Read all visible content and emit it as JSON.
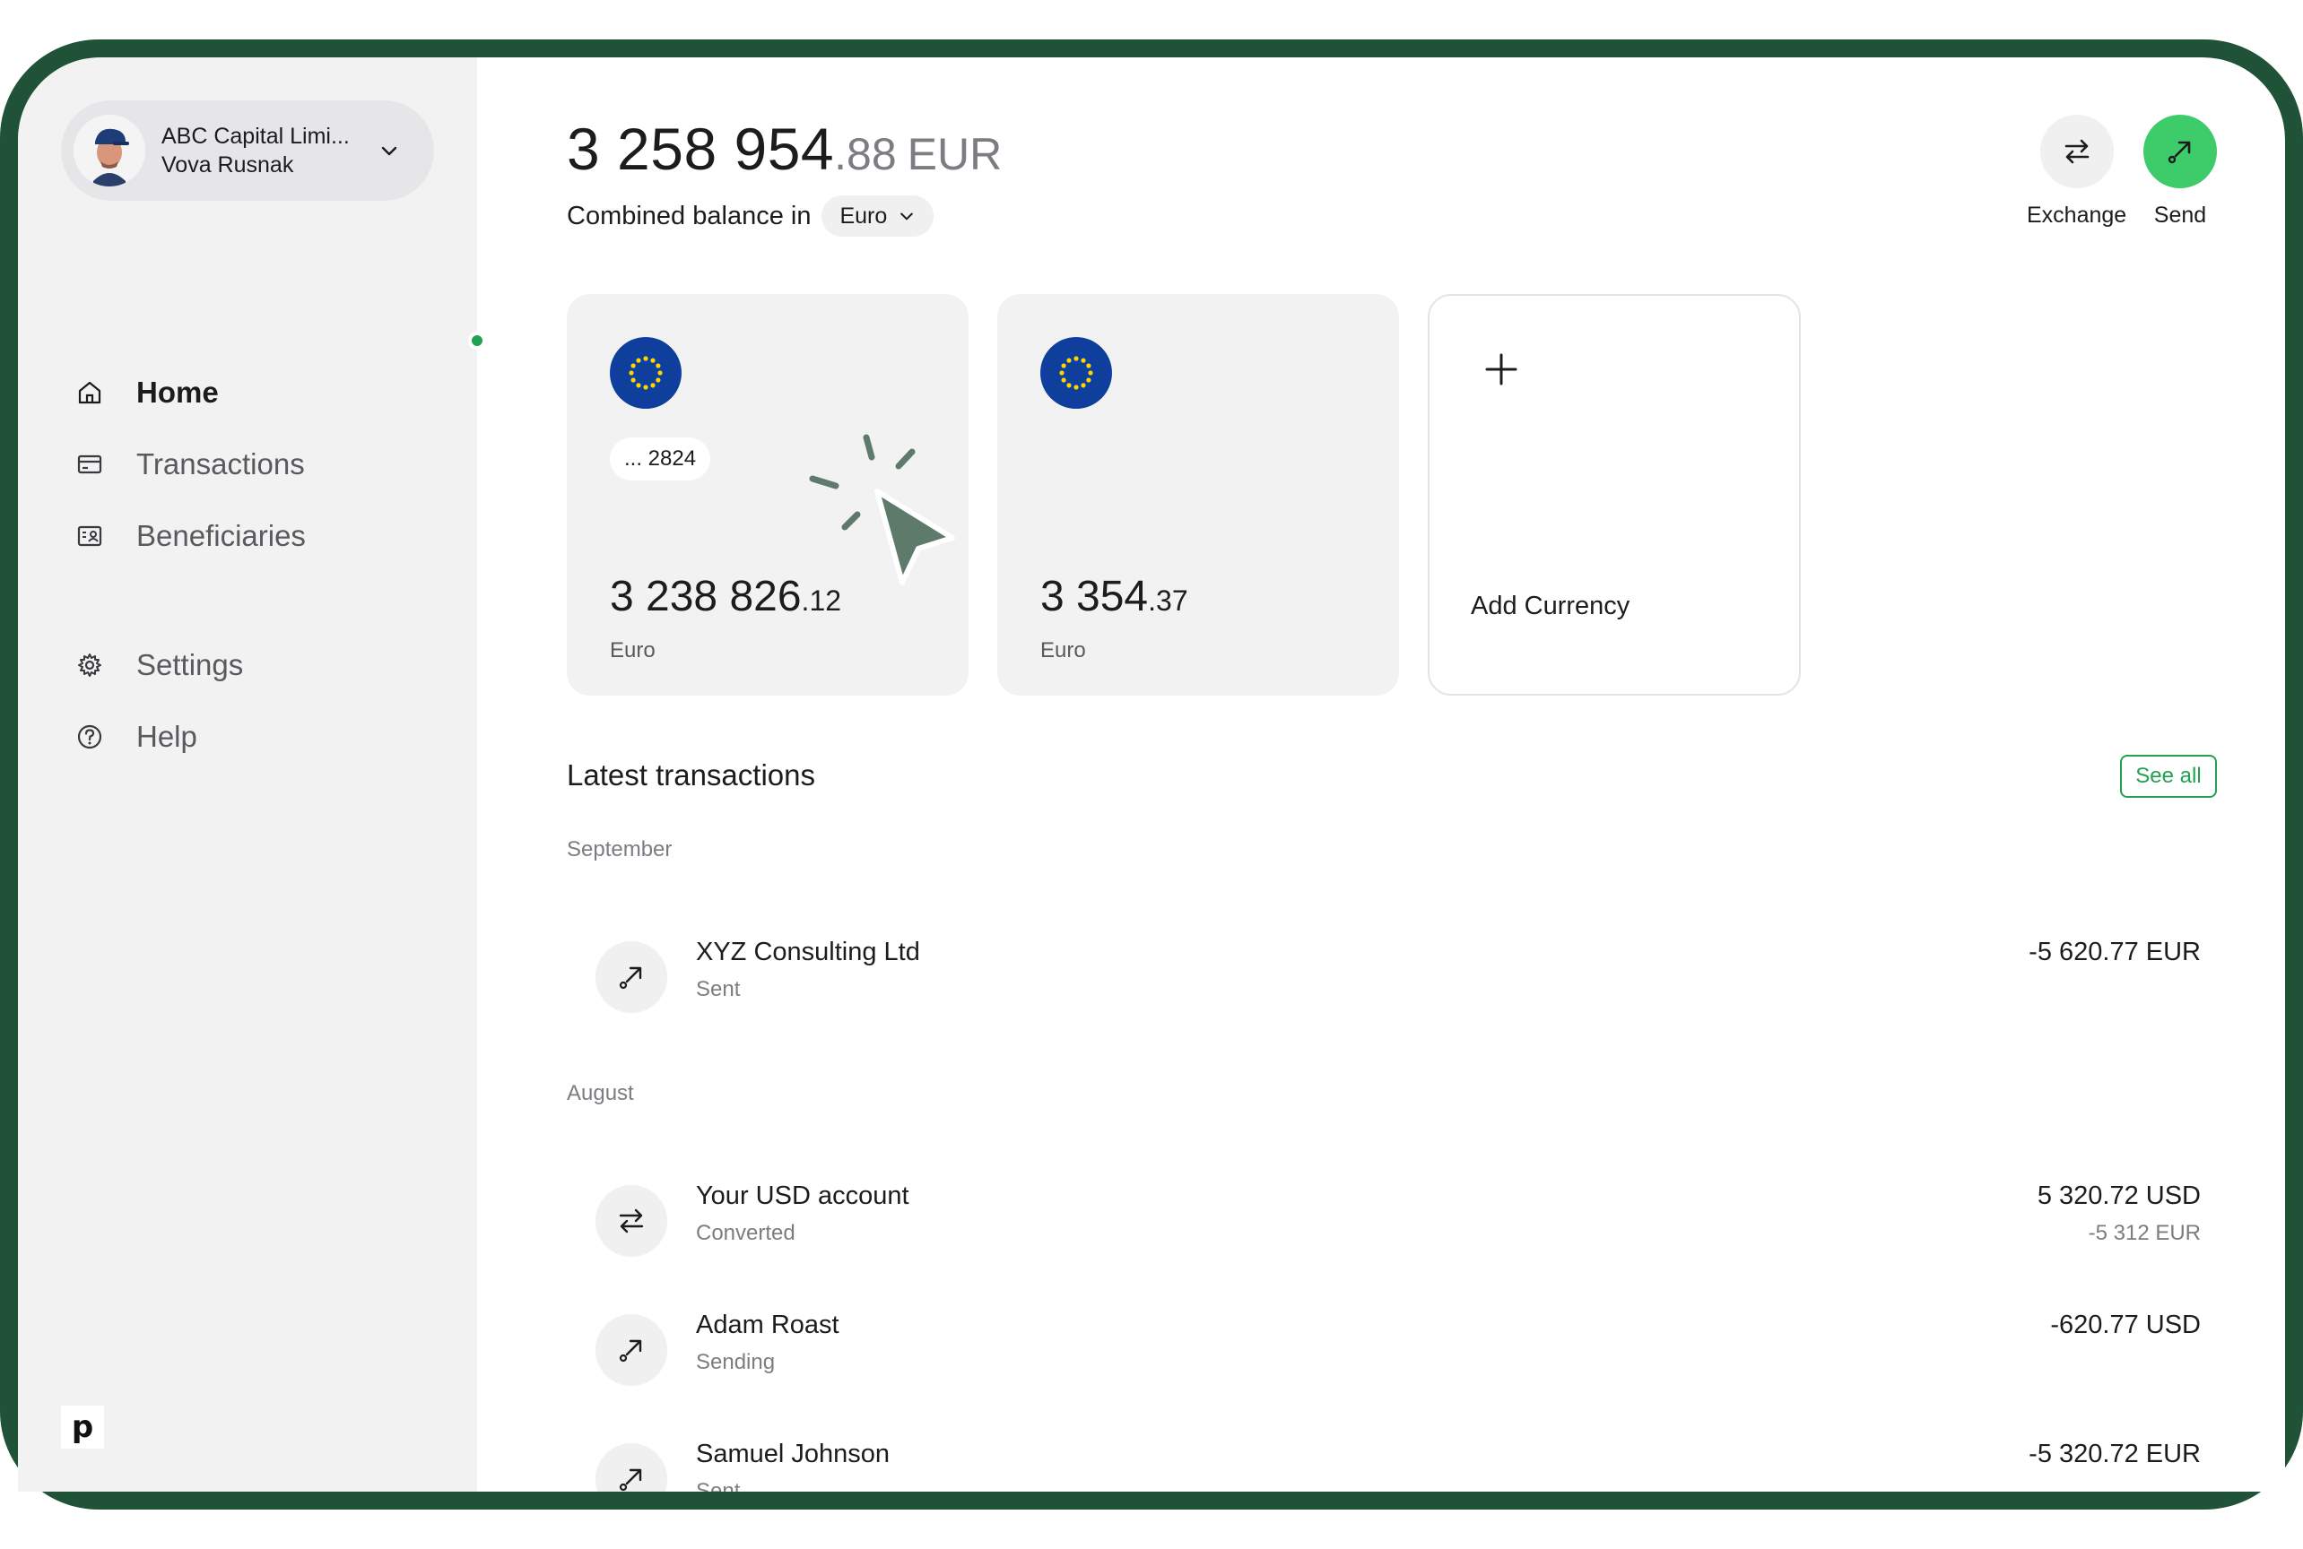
{
  "account": {
    "company": "ABC Capital Limi...",
    "user": "Vova Rusnak"
  },
  "nav": {
    "items": [
      {
        "label": "Home",
        "icon": "home-icon",
        "active": true
      },
      {
        "label": "Transactions",
        "icon": "card-icon",
        "active": false
      },
      {
        "label": "Beneficiaries",
        "icon": "contact-card-icon",
        "active": false
      },
      {
        "label": "Settings",
        "icon": "gear-icon",
        "active": false
      },
      {
        "label": "Help",
        "icon": "help-circle-icon",
        "active": false
      }
    ]
  },
  "brand": {
    "logo_text": "p"
  },
  "balance": {
    "integer": "3 258 954",
    "decimal": ".88",
    "currency": "EUR",
    "combined_label": "Combined balance in",
    "selected_currency": "Euro"
  },
  "actions": {
    "exchange_label": "Exchange",
    "send_label": "Send"
  },
  "cards": [
    {
      "account_suffix": "... 2824",
      "amount_int": "3 238 826",
      "amount_dec": ".12",
      "currency": "Euro",
      "flag": "eu-flag-icon"
    },
    {
      "account_suffix": "",
      "amount_int": "3 354",
      "amount_dec": ".37",
      "currency": "Euro",
      "flag": "eu-flag-icon"
    }
  ],
  "add_card": {
    "label": "Add Currency"
  },
  "latest": {
    "title": "Latest transactions",
    "see_all": "See all",
    "groups": [
      {
        "month": "September",
        "items": [
          {
            "name": "XYZ Consulting Ltd",
            "status": "Sent",
            "amount": "-5 620.77 EUR",
            "sub_amount": "",
            "icon": "send-arrow-icon"
          }
        ]
      },
      {
        "month": "August",
        "items": [
          {
            "name": "Your USD account",
            "status": "Converted",
            "amount": "5 320.72 USD",
            "sub_amount": "-5 312 EUR",
            "icon": "exchange-icon"
          },
          {
            "name": "Adam Roast",
            "status": "Sending",
            "amount": "-620.77 USD",
            "sub_amount": "",
            "icon": "send-arrow-icon"
          },
          {
            "name": "Samuel Johnson",
            "status": "Sent",
            "amount": "-5 320.72 EUR",
            "sub_amount": "",
            "icon": "send-arrow-icon"
          }
        ]
      }
    ]
  },
  "colors": {
    "frame": "#1f5236",
    "accent_green": "#22a152",
    "send_button": "#3ecb6a",
    "eu_blue": "#0f3f9c",
    "eu_star": "#ffd400",
    "cursor": "#5e7a6a"
  }
}
